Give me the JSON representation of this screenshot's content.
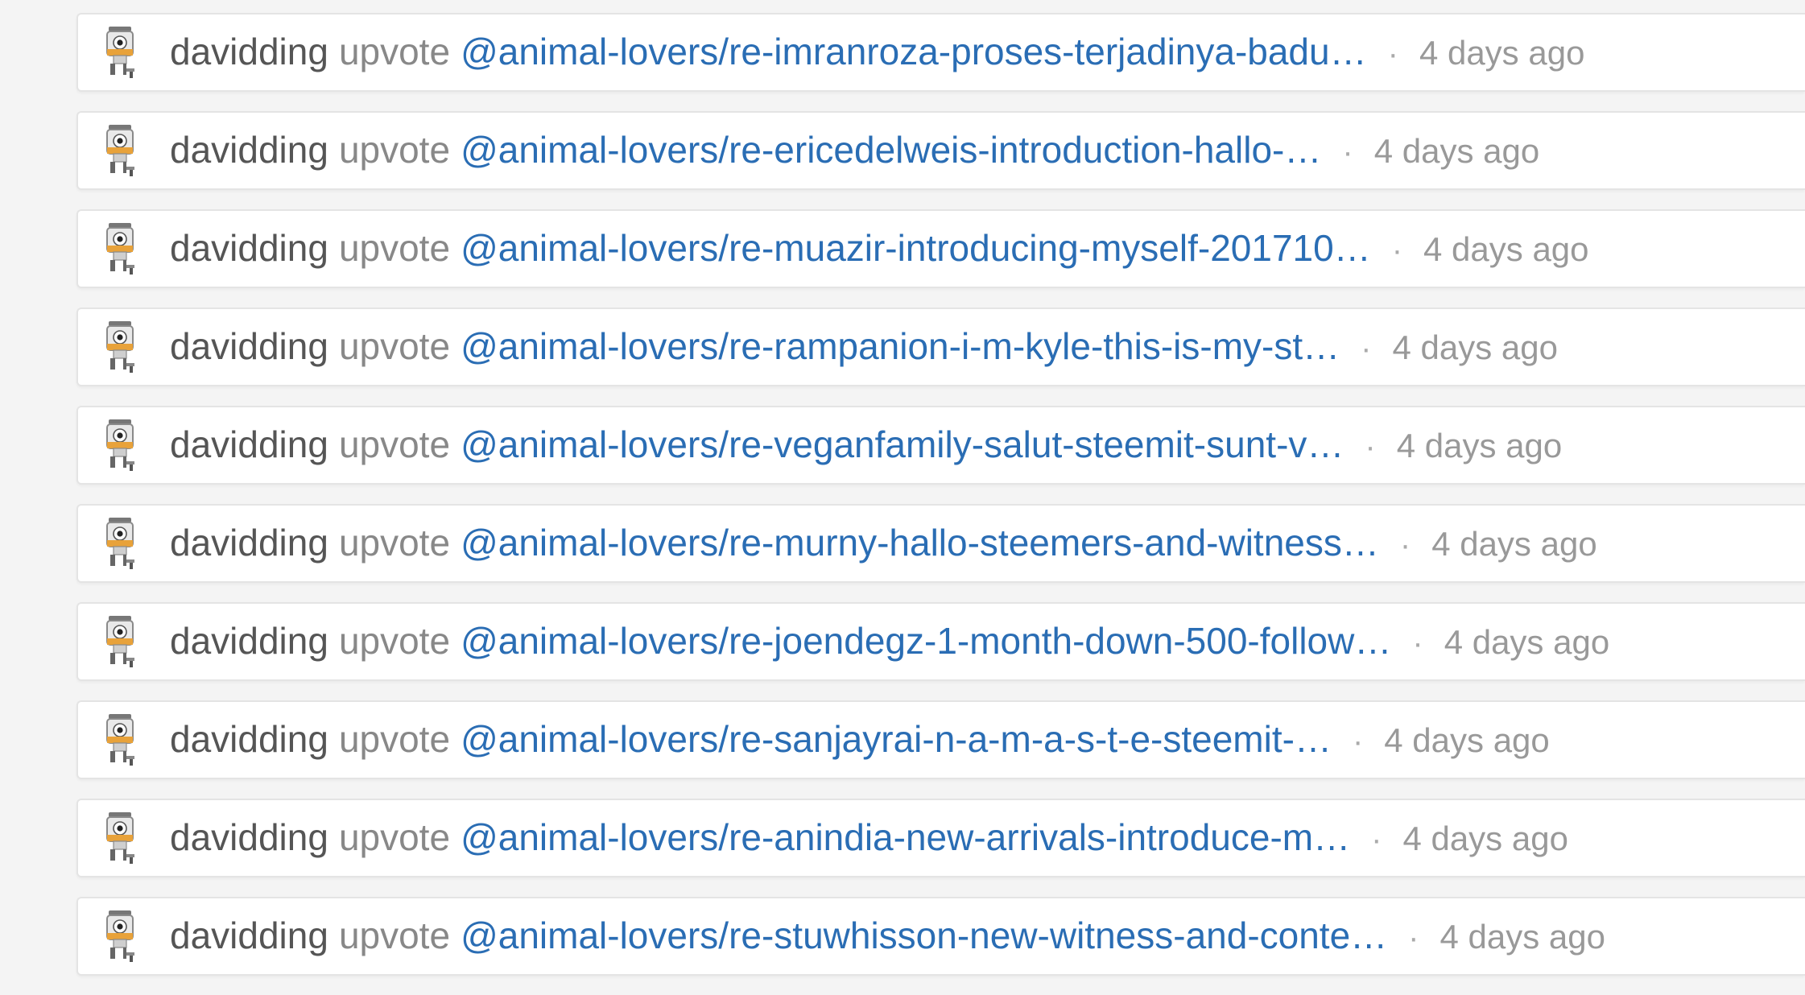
{
  "activity": [
    {
      "user": "davidding",
      "action": "upvote",
      "link": "@animal-lovers/re-imranroza-proses-terjadinya-badu…",
      "time": "4 days ago"
    },
    {
      "user": "davidding",
      "action": "upvote",
      "link": "@animal-lovers/re-ericedelweis-introduction-hallo-…",
      "time": "4 days ago"
    },
    {
      "user": "davidding",
      "action": "upvote",
      "link": "@animal-lovers/re-muazir-introducing-myself-201710…",
      "time": "4 days ago"
    },
    {
      "user": "davidding",
      "action": "upvote",
      "link": "@animal-lovers/re-rampanion-i-m-kyle-this-is-my-st…",
      "time": "4 days ago"
    },
    {
      "user": "davidding",
      "action": "upvote",
      "link": "@animal-lovers/re-veganfamily-salut-steemit-sunt-v…",
      "time": "4 days ago"
    },
    {
      "user": "davidding",
      "action": "upvote",
      "link": "@animal-lovers/re-murny-hallo-steemers-and-witness…",
      "time": "4 days ago"
    },
    {
      "user": "davidding",
      "action": "upvote",
      "link": "@animal-lovers/re-joendegz-1-month-down-500-follow…",
      "time": "4 days ago"
    },
    {
      "user": "davidding",
      "action": "upvote",
      "link": "@animal-lovers/re-sanjayrai-n-a-m-a-s-t-e-steemit-…",
      "time": "4 days ago"
    },
    {
      "user": "davidding",
      "action": "upvote",
      "link": "@animal-lovers/re-anindia-new-arrivals-introduce-m…",
      "time": "4 days ago"
    },
    {
      "user": "davidding",
      "action": "upvote",
      "link": "@animal-lovers/re-stuwhisson-new-witness-and-conte…",
      "time": "4 days ago"
    }
  ],
  "separator": "·",
  "icons": {
    "avatar": "robot-avatar-icon"
  },
  "colors": {
    "link": "#2a6db4",
    "user": "#555555",
    "action": "#888888",
    "time": "#999999"
  }
}
